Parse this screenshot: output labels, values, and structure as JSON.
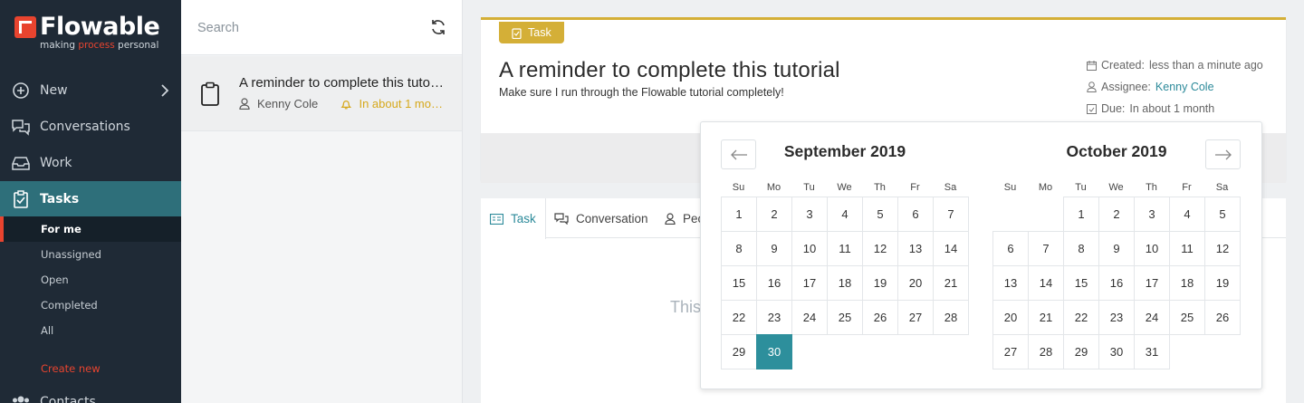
{
  "brand": {
    "name": "Flowable",
    "tagline_pre": "making ",
    "tagline_accent": "process",
    "tagline_post": " personal"
  },
  "sidebar": {
    "items": [
      {
        "label": "New",
        "icon": "plus-circle-icon"
      },
      {
        "label": "Conversations",
        "icon": "chat-bubbles-icon"
      },
      {
        "label": "Work",
        "icon": "inbox-icon"
      },
      {
        "label": "Tasks",
        "icon": "clipboard-check-icon"
      }
    ],
    "sub_items": [
      "For me",
      "Unassigned",
      "Open",
      "Completed",
      "All"
    ],
    "create_new": "Create new",
    "contacts": "Contacts"
  },
  "search": {
    "placeholder": "Search"
  },
  "task_list": [
    {
      "title": "A reminder to complete this tutorial",
      "assignee": "Kenny Cole",
      "due": "In about 1 month"
    }
  ],
  "detail": {
    "badge": "Task",
    "title": "A reminder to complete this tutorial",
    "description": "Make sure I run through the Flowable tutorial completely!",
    "created_label": "Created:",
    "created_value": "less than a minute ago",
    "assignee_label": "Assignee:",
    "assignee_value": "Kenny Cole",
    "due_label": "Due:",
    "due_value": "In about 1 month"
  },
  "tabs": [
    "Task",
    "Conversation",
    "Peo"
  ],
  "empty_text": "This",
  "datepicker": {
    "weekdays": [
      "Su",
      "Mo",
      "Tu",
      "We",
      "Th",
      "Fr",
      "Sa"
    ],
    "selected_day": 30,
    "months": [
      {
        "title": "September 2019",
        "offset": 0,
        "days": 30
      },
      {
        "title": "October 2019",
        "offset": 2,
        "days": 31
      }
    ]
  },
  "colors": {
    "accent": "#2d8f9c",
    "brand_red": "#e8442f",
    "due_gold": "#d4af37"
  }
}
